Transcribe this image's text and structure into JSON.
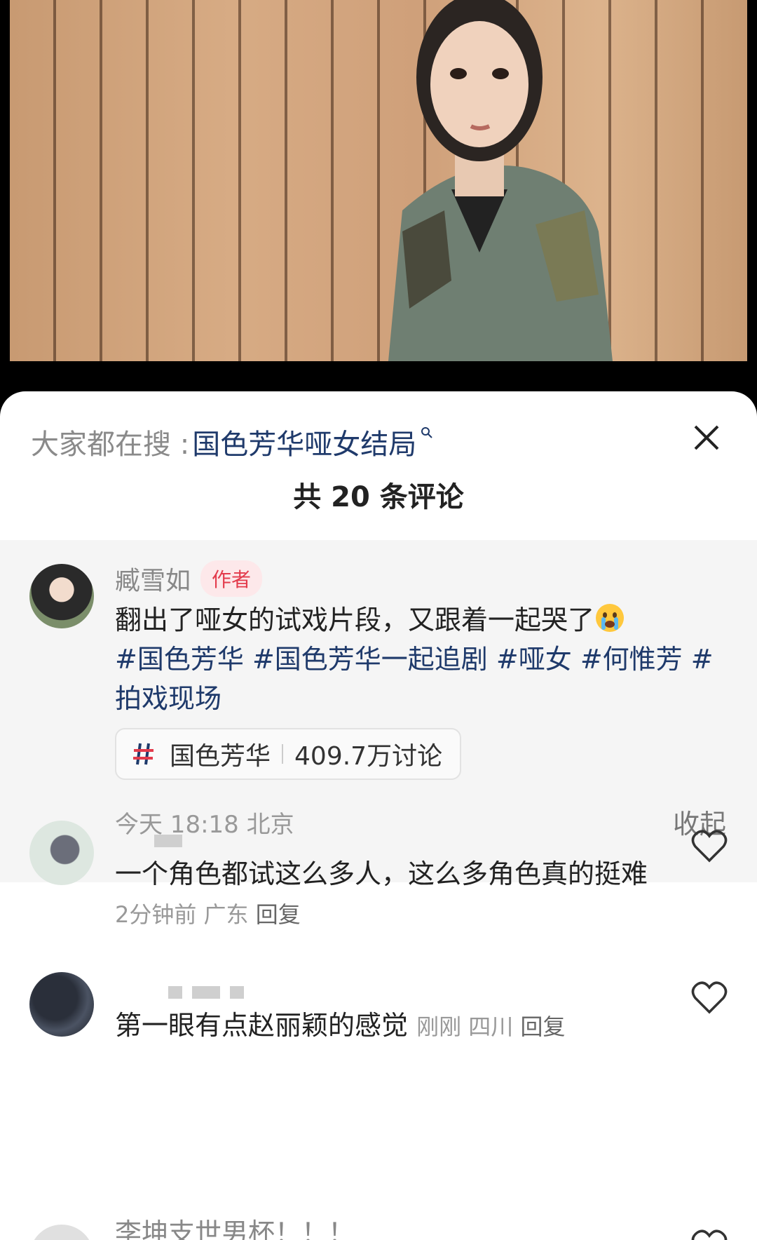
{
  "search": {
    "prefix": "大家都在搜 : ",
    "term": "国色芳华哑女结局"
  },
  "header": {
    "comment_count": "共 20 条评论"
  },
  "author_post": {
    "name": "臧雪如",
    "badge": "作者",
    "text": "翻出了哑女的试戏片段，又跟着一起哭了",
    "hashtags": [
      "#国色芳华",
      "#国色芳华一起追剧",
      "#哑女",
      "#何惟芳",
      "#拍戏现场"
    ],
    "topic": {
      "name": "国色芳华",
      "count": "409.7万讨论"
    },
    "meta": "今天 18:18 北京",
    "collapse_label": "收起"
  },
  "comments": [
    {
      "text": "一个角色都试这么多人，这么多角色真的挺难",
      "time": "2分钟前",
      "location": "广东",
      "reply_label": "回复"
    },
    {
      "text": "第一眼有点赵丽颖的感觉",
      "time": "刚刚",
      "location": "四川",
      "reply_label": "回复"
    },
    {
      "text": "李坤支世男杯！！！"
    }
  ],
  "colors": {
    "hashtag": "#1f3a6b",
    "badge_text": "#e33b4c",
    "badge_bg": "#fde8ea"
  }
}
